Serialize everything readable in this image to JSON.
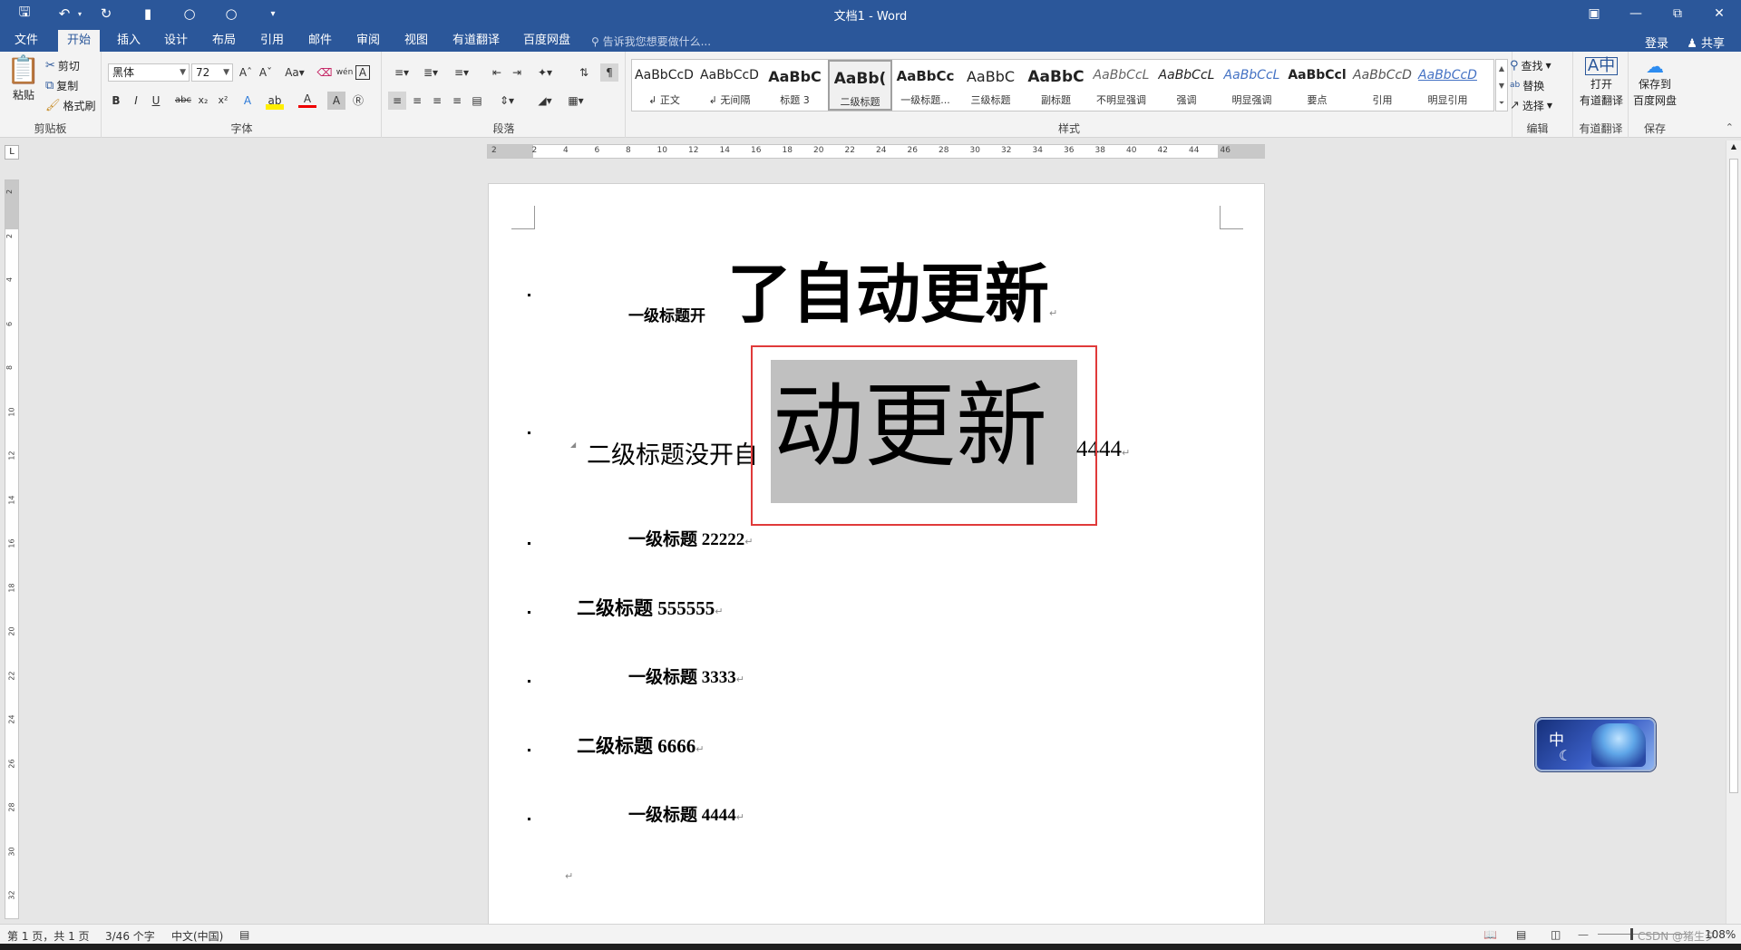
{
  "window": {
    "title": "文档1 - Word"
  },
  "tabs": [
    "文件",
    "开始",
    "插入",
    "设计",
    "布局",
    "引用",
    "邮件",
    "审阅",
    "视图",
    "有道翻译",
    "百度网盘"
  ],
  "tell_me": "告诉我您想要做什么...",
  "account": {
    "signin": "登录",
    "share": "共享"
  },
  "clipboard": {
    "paste": "粘贴",
    "cut": "剪切",
    "copy": "复制",
    "format_painter": "格式刷",
    "label": "剪贴板"
  },
  "font": {
    "name": "黑体",
    "size": "72",
    "label": "字体"
  },
  "paragraph": {
    "label": "段落"
  },
  "styles": {
    "label": "样式",
    "items": [
      {
        "sample": "AaBbCcD",
        "name": "↲ 正文"
      },
      {
        "sample": "AaBbCcD",
        "name": "↲ 无间隔"
      },
      {
        "sample": "AaBbC",
        "name": "标题 3"
      },
      {
        "sample": "AaBb(",
        "name": "二级标题"
      },
      {
        "sample": "AaBbCc",
        "name": "一级标题..."
      },
      {
        "sample": "AaBbC",
        "name": "三级标题"
      },
      {
        "sample": "AaBbC",
        "name": "副标题"
      },
      {
        "sample": "AaBbCcL",
        "name": "不明显强调"
      },
      {
        "sample": "AaBbCcL",
        "name": "强调"
      },
      {
        "sample": "AaBbCcL",
        "name": "明显强调"
      },
      {
        "sample": "AaBbCcl",
        "name": "要点"
      },
      {
        "sample": "AaBbCcD",
        "name": "引用"
      },
      {
        "sample": "AaBbCcD",
        "name": "明显引用"
      }
    ]
  },
  "editing": {
    "find": "查找",
    "replace": "替换",
    "select": "选择",
    "label": "编辑"
  },
  "youdao": {
    "line1": "打开",
    "line2": "有道翻译",
    "label": "有道翻译"
  },
  "baidu": {
    "line1": "保存到",
    "line2": "百度网盘",
    "label": "保存"
  },
  "ruler": {
    "ticks": [
      "2",
      "2",
      "4",
      "6",
      "8",
      "10",
      "12",
      "14",
      "16",
      "18",
      "20",
      "22",
      "24",
      "26",
      "28",
      "30",
      "32",
      "34",
      "36",
      "38",
      "40",
      "42",
      "44",
      "46"
    ]
  },
  "vruler": {
    "ticks": [
      "2",
      "2",
      "4",
      "6",
      "8",
      "10",
      "12",
      "14",
      "16",
      "18",
      "20",
      "22",
      "24",
      "26",
      "28",
      "30",
      "32"
    ]
  },
  "document": {
    "p1_small": "一级标题开",
    "p1_big": "了自动更新",
    "p2_prefix": "二级标题没开自",
    "p2_selected": "动更新",
    "p2_suffix": "4444",
    "p3": "一级标题 22222",
    "p4": "二级标题 555555",
    "p5": "一级标题 3333",
    "p6": "二级标题 6666",
    "p7": "一级标题 4444"
  },
  "ime": {
    "lang": "中"
  },
  "status": {
    "page": "第 1 页，共 1 页",
    "words": "3/46 个字",
    "lang": "中文(中国)",
    "zoom": "108%",
    "watermark": "CSDN @猪生夕"
  },
  "colors": {
    "accent": "#2b579a",
    "selection": "#c0c0c0",
    "highlight_box": "#e03a3a"
  }
}
